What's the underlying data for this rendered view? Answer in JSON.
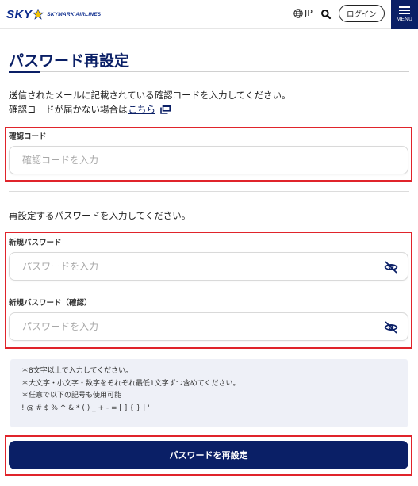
{
  "header": {
    "logo_text": "SKY",
    "logo_sub": "SKYMARK AIRLINES",
    "lang_label": "JP",
    "login_label": "ログイン",
    "menu_label": "MENU"
  },
  "page": {
    "title": "パスワード再設定",
    "intro_line1": "送信されたメールに記載されている確認コードを入力してください。",
    "intro_line2_prefix": "確認コードが届かない場合は",
    "intro_link": "こちら"
  },
  "code_field": {
    "label": "確認コード",
    "placeholder": "確認コードを入力",
    "value": ""
  },
  "password_section": {
    "instruction": "再設定するパスワードを入力してください。",
    "new_password": {
      "label": "新規パスワード",
      "placeholder": "パスワードを入力",
      "value": ""
    },
    "confirm_password": {
      "label": "新規パスワード（確認）",
      "placeholder": "パスワードを入力",
      "value": ""
    }
  },
  "rules": {
    "line1": "＊8文字以上で入力してください。",
    "line2": "＊大文字・小文字・数字をそれぞれ最低1文字ずつ含めてください。",
    "line3": "＊任意で以下の記号も使用可能",
    "line4": "! @ # $ % ^ & * ( ) _ + - = [ ] { } | '"
  },
  "submit": {
    "label": "パスワードを再設定"
  },
  "colors": {
    "brand_navy": "#0a1f66",
    "highlight_red": "#e0242b",
    "rules_bg": "#eef0f7"
  }
}
